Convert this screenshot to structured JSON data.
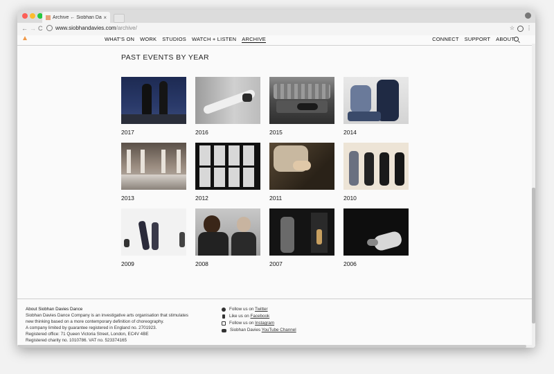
{
  "browser": {
    "tab_title": "Archive ← Siobhan Davies Danc",
    "tab_close": "×",
    "url_host": "www.siobhandavies.com",
    "url_path": "/archive/",
    "back": "←",
    "forward": "→",
    "reload": "C",
    "star": "☆",
    "menu": "⋮"
  },
  "nav": {
    "left": [
      "WHAT'S ON",
      "WORK",
      "STUDIOS",
      "WATCH + LISTEN",
      "ARCHIVE"
    ],
    "right": [
      "CONNECT",
      "SUPPORT",
      "ABOUT"
    ],
    "active": "ARCHIVE"
  },
  "page": {
    "title": "PAST EVENTS BY YEAR"
  },
  "years": [
    {
      "label": "2017"
    },
    {
      "label": "2016"
    },
    {
      "label": "2015"
    },
    {
      "label": "2014"
    },
    {
      "label": "2013"
    },
    {
      "label": "2012"
    },
    {
      "label": "2011"
    },
    {
      "label": "2010"
    },
    {
      "label": "2009"
    },
    {
      "label": "2008"
    },
    {
      "label": "2007"
    },
    {
      "label": "2006"
    }
  ],
  "footer": {
    "about_title": "About Siobhan Davies Dance",
    "about_line1": "Siobhan Davies Dance Company is an investigative arts organisation that stimulates",
    "about_line2": "new thinking based on a more contemporary definition of choreography.",
    "about_line3": "A company limited by guarantee registered in England no. 2701923.",
    "about_line4": "Registered office: 71 Queen Victoria Street, London, EC4V 4BE",
    "about_line5": "Registered charity no. 1010786. VAT no. 523374165",
    "twitter_prefix": "Follow us on ",
    "twitter_link": "Twitter",
    "facebook_prefix": "Like us on ",
    "facebook_link": "Facebook",
    "instagram_prefix": "Follow us on ",
    "instagram_link": "Instagram",
    "youtube_prefix": "Siobhan Davies ",
    "youtube_link": "YouTube Channel"
  },
  "colors": {
    "logo": "#f09a4a",
    "text": "#111111"
  }
}
